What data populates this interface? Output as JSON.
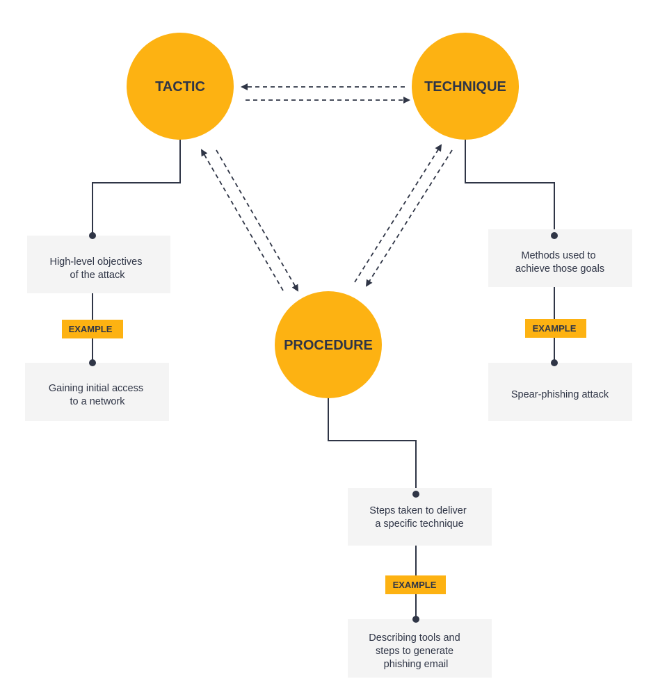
{
  "colors": {
    "accent": "#FDB212",
    "dark": "#2F3546",
    "box": "#F4F4F4"
  },
  "nodes": {
    "tactic": {
      "label": "TACTIC",
      "description": [
        "High-level objectives",
        "of the attack"
      ],
      "badge": "EXAMPLE",
      "example": [
        "Gaining initial access",
        "to a network"
      ]
    },
    "technique": {
      "label": "TECHNIQUE",
      "description": [
        "Methods used to",
        "achieve those goals"
      ],
      "badge": "EXAMPLE",
      "example": [
        "Spear-phishing attack"
      ]
    },
    "procedure": {
      "label": "PROCEDURE",
      "description": [
        "Steps taken to deliver",
        "a specific technique"
      ],
      "badge": "EXAMPLE",
      "example": [
        "Describing tools and",
        "steps to generate",
        "phishing email"
      ]
    }
  }
}
